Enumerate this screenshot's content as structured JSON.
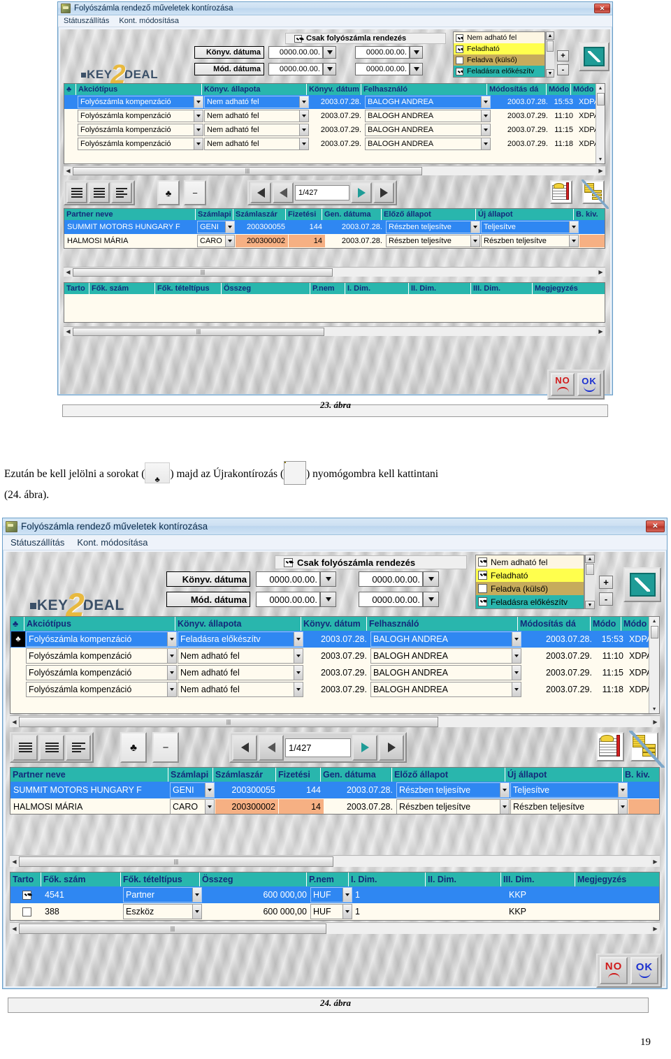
{
  "document": {
    "paragraph_line1_pre": "Ezután be kell jelölni a sorokat (",
    "paragraph_line1_mid": ") majd az Újrakontírozás (",
    "paragraph_line1_post": ") nyomógombra kell kattintani",
    "paragraph_line2": "(24. ábra).",
    "figure_caption_1": "23. ábra",
    "figure_caption_2": "24. ábra",
    "page_number": "19"
  },
  "window": {
    "title": "Folyószámla rendező műveletek kontírozása",
    "title_icon": "application-icon",
    "close_label": "✕",
    "menu": [
      "Státuszállítás",
      "Kont. módosítása"
    ],
    "logo": {
      "pre": "KEY",
      "big": "2",
      "post": "DEAL"
    },
    "filters": {
      "only_checkbox_label": "Csak folyószámla rendezés",
      "only_checkbox_checked": true,
      "rows": [
        {
          "label": "Könyv. dátuma",
          "from": "0000.00.00.",
          "to": "0000.00.00."
        },
        {
          "label": "Mód. dátuma",
          "from": "0000.00.00.",
          "to": "0000.00.00."
        }
      ]
    },
    "state_list": [
      {
        "label": "Nem adható fel",
        "checked": true,
        "color": "#fdf6e3"
      },
      {
        "label": "Feladható",
        "checked": true,
        "color": "#ffff4d"
      },
      {
        "label": "Feladva (külső)",
        "checked": false,
        "color": "#c6ab5c"
      },
      {
        "label": "Feladásra előkészítv",
        "checked": true,
        "color": "#29b6ad"
      }
    ],
    "plus_label": "+",
    "minus_label": "-",
    "edit_icon": "pencil-edit-icon"
  },
  "grid_actions": {
    "headers": [
      "♣",
      "Akciótípus",
      "Könyv. állapota",
      "Könyv. dátum",
      "Felhasználó",
      "Módosítás dá",
      "Módo",
      "Módo"
    ],
    "rows_fig23": [
      {
        "mark": "",
        "tipus": "Folyószámla kompenzáció",
        "allapot": "Nem adható fel",
        "datum": "2003.07.28.",
        "user": "BALOGH ANDREA",
        "moddat": "2003.07.28.",
        "modido": "15:53",
        "moduser": "XDPA",
        "selected": true
      },
      {
        "mark": "",
        "tipus": "Folyószámla kompenzáció",
        "allapot": "Nem adható fel",
        "datum": "2003.07.29.",
        "user": "BALOGH ANDREA",
        "moddat": "2003.07.29.",
        "modido": "11:10",
        "moduser": "XDPA",
        "selected": false
      },
      {
        "mark": "",
        "tipus": "Folyószámla kompenzáció",
        "allapot": "Nem adható fel",
        "datum": "2003.07.29.",
        "user": "BALOGH ANDREA",
        "moddat": "2003.07.29.",
        "modido": "11:15",
        "moduser": "XDPA",
        "selected": false
      },
      {
        "mark": "",
        "tipus": "Folyószámla kompenzáció",
        "allapot": "Nem adható fel",
        "datum": "2003.07.29.",
        "user": "BALOGH ANDREA",
        "moddat": "2003.07.29.",
        "modido": "11:18",
        "moduser": "XDPA",
        "selected": false
      }
    ],
    "rows_fig24": [
      {
        "mark": "♣",
        "tipus": "Folyószámla kompenzáció",
        "allapot": "Feladásra előkészítv",
        "datum": "2003.07.28.",
        "user": "BALOGH ANDREA",
        "moddat": "2003.07.28.",
        "modido": "15:53",
        "moduser": "XDPA",
        "selected": true
      },
      {
        "mark": "",
        "tipus": "Folyószámla kompenzáció",
        "allapot": "Nem adható fel",
        "datum": "2003.07.29.",
        "user": "BALOGH ANDREA",
        "moddat": "2003.07.29.",
        "modido": "11:10",
        "moduser": "XDPA",
        "selected": false
      },
      {
        "mark": "",
        "tipus": "Folyószámla kompenzáció",
        "allapot": "Nem adható fel",
        "datum": "2003.07.29.",
        "user": "BALOGH ANDREA",
        "moddat": "2003.07.29.",
        "modido": "11:15",
        "moduser": "XDPA",
        "selected": false
      },
      {
        "mark": "",
        "tipus": "Folyószámla kompenzáció",
        "allapot": "Nem adható fel",
        "datum": "2003.07.29.",
        "user": "BALOGH ANDREA",
        "moddat": "2003.07.29.",
        "modido": "11:18",
        "moduser": "XDPA",
        "selected": false
      }
    ]
  },
  "toolbar": {
    "help_list_icon": "question-list-icon",
    "list_icon": "list-icon",
    "indent_list_icon": "indent-list-icon",
    "mark_icon": "♣",
    "unmark_icon": "−",
    "first_icon": "first-record-icon",
    "prev_icon": "prev-record-icon",
    "page_value": "1/427",
    "next_icon": "next-record-icon",
    "last_icon": "last-record-icon",
    "ledger_icon": "ledger-note-icon",
    "rebook_icon": "rebook-icon"
  },
  "grid_partner": {
    "headers": [
      "Partner neve",
      "Számlapi",
      "Számlaszár",
      "Fizetési",
      "Gen. dátuma",
      "Előző állapot",
      "Új állapot",
      "B. kiv."
    ],
    "rows": [
      {
        "partner": "SUMMIT MOTORS HUNGARY F",
        "szamlapi": "GENI",
        "szamlaszam": "200300055",
        "fizetesi": "144",
        "gendat": "2003.07.28.",
        "elozo": "Részben teljesítve",
        "uj": "Teljesítve",
        "bkiv": "",
        "selected": true
      },
      {
        "partner": "HALMOSI MÁRIA",
        "szamlapi": "CARO",
        "szamlaszam": "200300002",
        "fizetesi": "14",
        "gendat": "2003.07.28.",
        "elozo": "Részben teljesítve",
        "uj": "Részben teljesítve",
        "bkiv": "",
        "selected": false
      }
    ]
  },
  "grid_items": {
    "headers": [
      "Tarto",
      "Fők. szám",
      "Fők. tételtípus",
      "Összeg",
      "P.nem",
      "I. Dim.",
      "II. Dim.",
      "III. Dim.",
      "Megjegyzés"
    ],
    "rows_fig23": [],
    "rows_fig24": [
      {
        "tarto": true,
        "fokszam": "4541",
        "teteltipus": "Partner",
        "osszeg": "600 000,00",
        "pnem": "HUF",
        "dim1": "1",
        "dim2": "",
        "dim3": "KKP",
        "megjegyzes": "",
        "selected": true
      },
      {
        "tarto": false,
        "fokszam": "388",
        "teteltipus": "Eszköz",
        "osszeg": "600 000,00",
        "pnem": "HUF",
        "dim1": "1",
        "dim2": "",
        "dim3": "KKP",
        "megjegyzes": "",
        "selected": false
      }
    ]
  },
  "footer_buttons": {
    "no_label": "NO",
    "ok_label": "OK"
  },
  "colors": {
    "header_teal": "#29b6ad",
    "header_text": "#132a7a",
    "selection_blue": "#2f87f2",
    "orange_cell": "#f6b083",
    "yellow_state": "#ffff4d",
    "titlebar_blue": "#bdd6ee"
  }
}
